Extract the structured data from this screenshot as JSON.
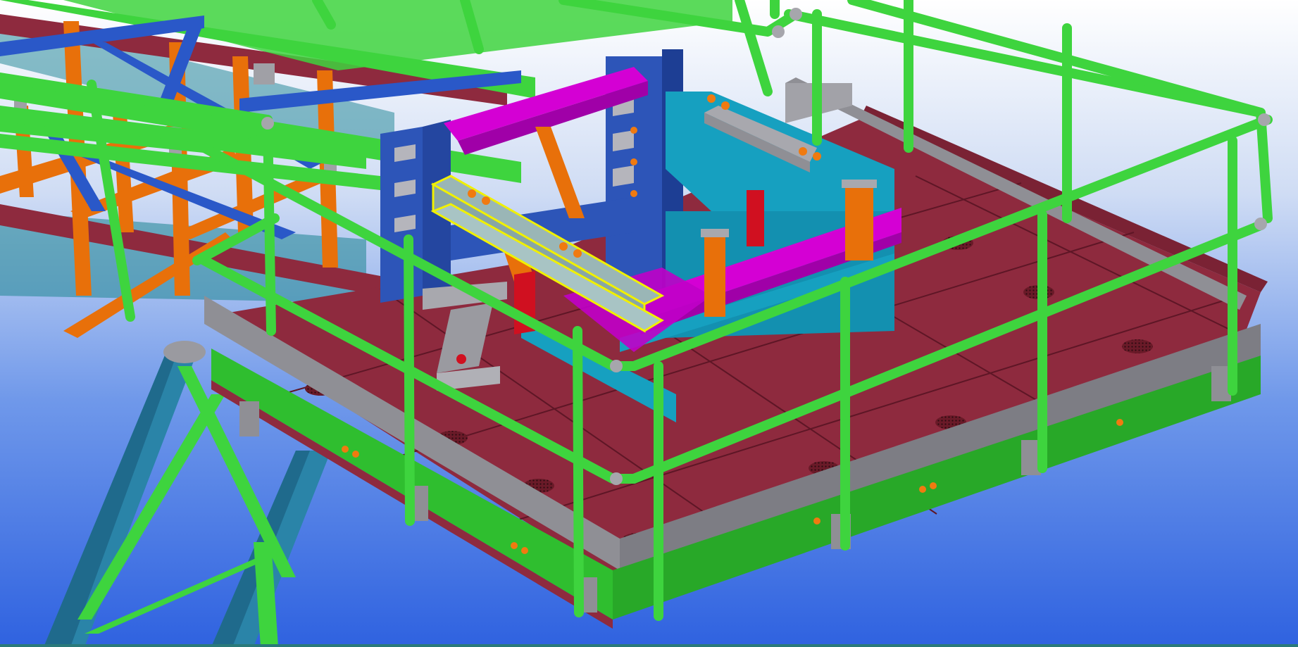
{
  "viewport": {
    "type": "3d-model-view",
    "background_top": "#ffffff",
    "background_bottom": "#2f62e0"
  },
  "colors": {
    "handrail": "#3ed43e",
    "handrail_dark": "#22a022",
    "deck_plate": "#8e2a3e",
    "kick_plate": "#8f8f95",
    "truss_orange": "#e8700a",
    "brace_blue": "#2a58c8",
    "column_blue": "#2d55b8",
    "beam_magenta": "#d400d4",
    "beam_cyan": "#16a0c0",
    "strut_teal": "#2a84a8",
    "bolt_orange": "#f07a10",
    "selection_yellow": "#f0f000",
    "plate_red": "#d01020"
  },
  "model": {
    "visible_parts": [
      "handrail-system",
      "deck-plate",
      "kick-plate",
      "conveyor-truss",
      "support-column",
      "magenta-beam",
      "cyan-beam",
      "selected-channel",
      "bearing-support",
      "perimeter-beam",
      "support-struts"
    ],
    "selected_part": "selected-channel"
  }
}
